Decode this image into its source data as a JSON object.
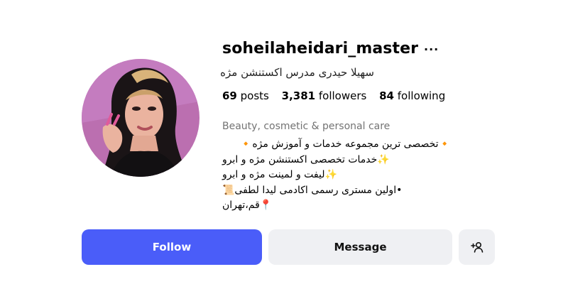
{
  "profile": {
    "username": "soheilaheidari_master",
    "more_glyph": "···",
    "full_name": "سهیلا حیدری مدرس اکستنشن مژه",
    "stats": {
      "posts_count": "69",
      "posts_label": "posts",
      "followers_count": "3,381",
      "followers_label": "followers",
      "following_count": "84",
      "following_label": "following"
    },
    "category": "Beauty, cosmetic & personal care",
    "bio": [
      "🔸تخصصی ترین مجموعه خدمات و آموزش مژه🔸",
      "✨خدمات تخصصی اکستنشن مژه و ابرو",
      "✨لیفت و لمینت مژه و ابرو",
      "•اولین مستری رسمی اکادمی لیدا لطفی📜",
      "📍قم،تهران"
    ]
  },
  "actions": {
    "follow_label": "Follow",
    "message_label": "Message",
    "suggest_icon": "add-person-icon"
  },
  "colors": {
    "follow_bg": "#4a5df9",
    "secondary_bg": "#eff0f3",
    "avatar_bg": "#bb6fb0"
  }
}
